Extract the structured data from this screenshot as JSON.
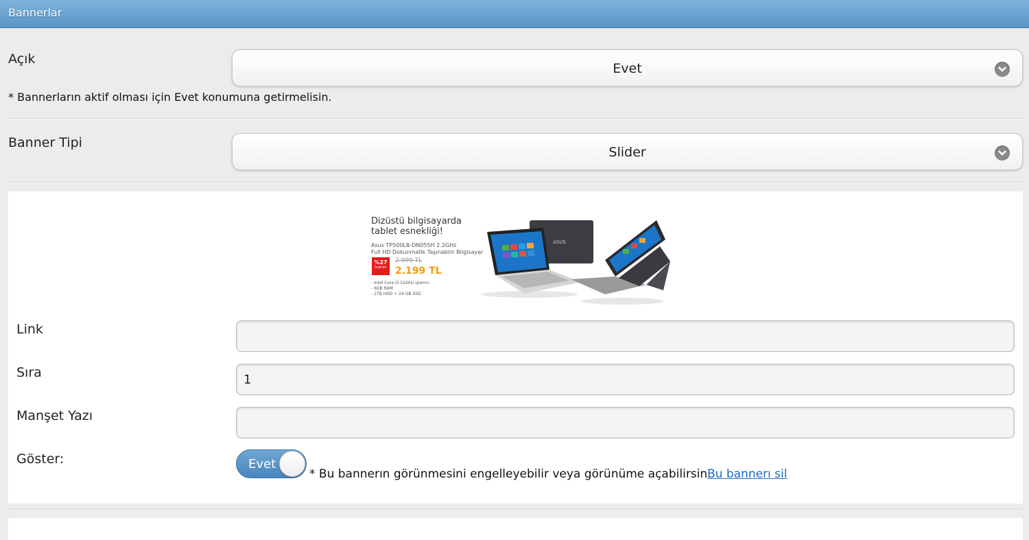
{
  "header": {
    "title": "Bannerlar"
  },
  "acik": {
    "label": "Açık",
    "value": "Evet",
    "note": "* Bannerların aktif olması için Evet konumuna getirmelisin."
  },
  "banner_tipi": {
    "label": "Banner Tipi",
    "value": "Slider"
  },
  "banner_image": {
    "line1": "Dizüstü bilgisayarda",
    "line2": "tablet esnekliği!",
    "model": "Asus TP500LB-DN055H 2.2GHz",
    "desc": "Full HD Dokunmatik Taşınabilir Bilgisayar",
    "discount": "%27",
    "discount_sub": "İndirim",
    "old_price": "2.999 TL",
    "new_price": "2.199 TL",
    "specs": [
      "- Intel Core i5 5200U işlemci",
      "- 6GB RAM",
      "- 1TB HDD + 24 GB SSD"
    ],
    "brand": "ASUS"
  },
  "form": {
    "link": {
      "label": "Link",
      "value": ""
    },
    "sira": {
      "label": "Sıra",
      "value": "1"
    },
    "manset": {
      "label": "Manşet Yazı",
      "value": ""
    },
    "goster": {
      "label": "Göster:",
      "toggle_label": "Evet",
      "note": "* Bu bannerın görünmesini engelleyebilir veya görünüme açabilirsin.",
      "delete_link": "Bu bannerı sil"
    }
  },
  "colors": {
    "header": "#5a96c8",
    "toggle": "#4a86bd",
    "price": "#f39a10",
    "badge": "#e31b1b",
    "link": "#1a6ac4"
  }
}
